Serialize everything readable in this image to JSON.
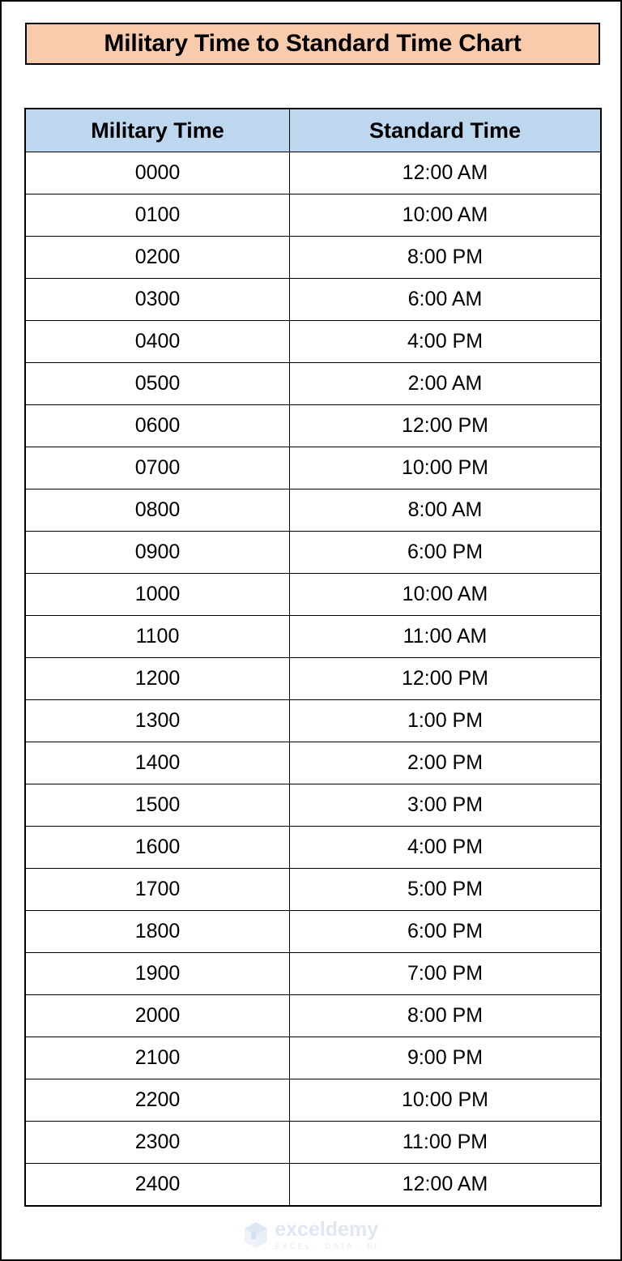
{
  "title": {
    "text": "Military Time to Standard Time Chart",
    "background_color": "#F8CBAD",
    "border_color": "#000000"
  },
  "table": {
    "header_background_color": "#BDD7EE",
    "border_color": "#000000",
    "columns": [
      "Military Time",
      "Standard Time"
    ],
    "rows": [
      [
        "0000",
        "12:00 AM"
      ],
      [
        "0100",
        "10:00 AM"
      ],
      [
        "0200",
        "8:00 PM"
      ],
      [
        "0300",
        "6:00 AM"
      ],
      [
        "0400",
        "4:00 PM"
      ],
      [
        "0500",
        "2:00 AM"
      ],
      [
        "0600",
        "12:00 PM"
      ],
      [
        "0700",
        "10:00 PM"
      ],
      [
        "0800",
        "8:00 AM"
      ],
      [
        "0900",
        "6:00 PM"
      ],
      [
        "1000",
        "10:00 AM"
      ],
      [
        "1100",
        "11:00 AM"
      ],
      [
        "1200",
        "12:00 PM"
      ],
      [
        "1300",
        "1:00 PM"
      ],
      [
        "1400",
        "2:00 PM"
      ],
      [
        "1500",
        "3:00 PM"
      ],
      [
        "1600",
        "4:00 PM"
      ],
      [
        "1700",
        "5:00 PM"
      ],
      [
        "1800",
        "6:00 PM"
      ],
      [
        "1900",
        "7:00 PM"
      ],
      [
        "2000",
        "8:00 PM"
      ],
      [
        "2100",
        "9:00 PM"
      ],
      [
        "2200",
        "10:00 PM"
      ],
      [
        "2300",
        "11:00 PM"
      ],
      [
        "2400",
        "12:00 AM"
      ]
    ]
  },
  "watermark": {
    "name": "exceldemy",
    "tagline": "EXCEL · DATA · BI",
    "logo_icon": "hexagon-logo-icon",
    "color": "#DDE6F2"
  },
  "chart_data": {
    "type": "table",
    "title": "Military Time to Standard Time Chart",
    "columns": [
      "Military Time",
      "Standard Time"
    ],
    "categories": [
      "0000",
      "0100",
      "0200",
      "0300",
      "0400",
      "0500",
      "0600",
      "0700",
      "0800",
      "0900",
      "1000",
      "1100",
      "1200",
      "1300",
      "1400",
      "1500",
      "1600",
      "1700",
      "1800",
      "1900",
      "2000",
      "2100",
      "2200",
      "2300",
      "2400"
    ],
    "series": [
      {
        "name": "Standard Time",
        "values": [
          "12:00 AM",
          "10:00 AM",
          "8:00 PM",
          "6:00 AM",
          "4:00 PM",
          "2:00 AM",
          "12:00 PM",
          "10:00 PM",
          "8:00 AM",
          "6:00 PM",
          "10:00 AM",
          "11:00 AM",
          "12:00 PM",
          "1:00 PM",
          "2:00 PM",
          "3:00 PM",
          "4:00 PM",
          "5:00 PM",
          "6:00 PM",
          "7:00 PM",
          "8:00 PM",
          "9:00 PM",
          "10:00 PM",
          "11:00 PM",
          "12:00 AM"
        ]
      }
    ],
    "row_count": 25,
    "xlabel": "Military Time",
    "ylabel": "Standard Time",
    "grid": true,
    "legend": "none"
  }
}
